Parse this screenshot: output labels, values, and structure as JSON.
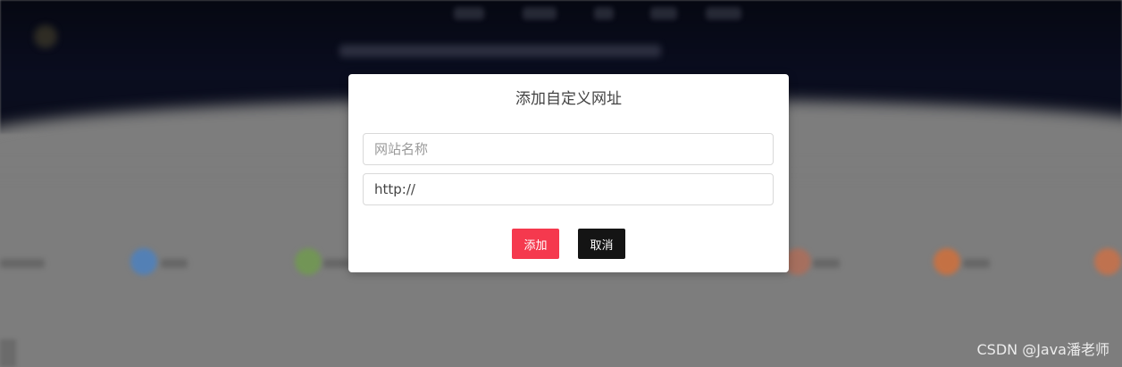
{
  "modal": {
    "title": "添加自定义网址",
    "name_input": {
      "placeholder": "网站名称",
      "value": ""
    },
    "url_input": {
      "placeholder": "",
      "value": "http://"
    },
    "add_label": "添加",
    "cancel_label": "取消"
  },
  "watermark": "CSDN @Java潘老师",
  "colors": {
    "add_button": "#f5394e",
    "cancel_button": "#141414",
    "backdrop": "#7d7d7d",
    "header": "#060812"
  }
}
